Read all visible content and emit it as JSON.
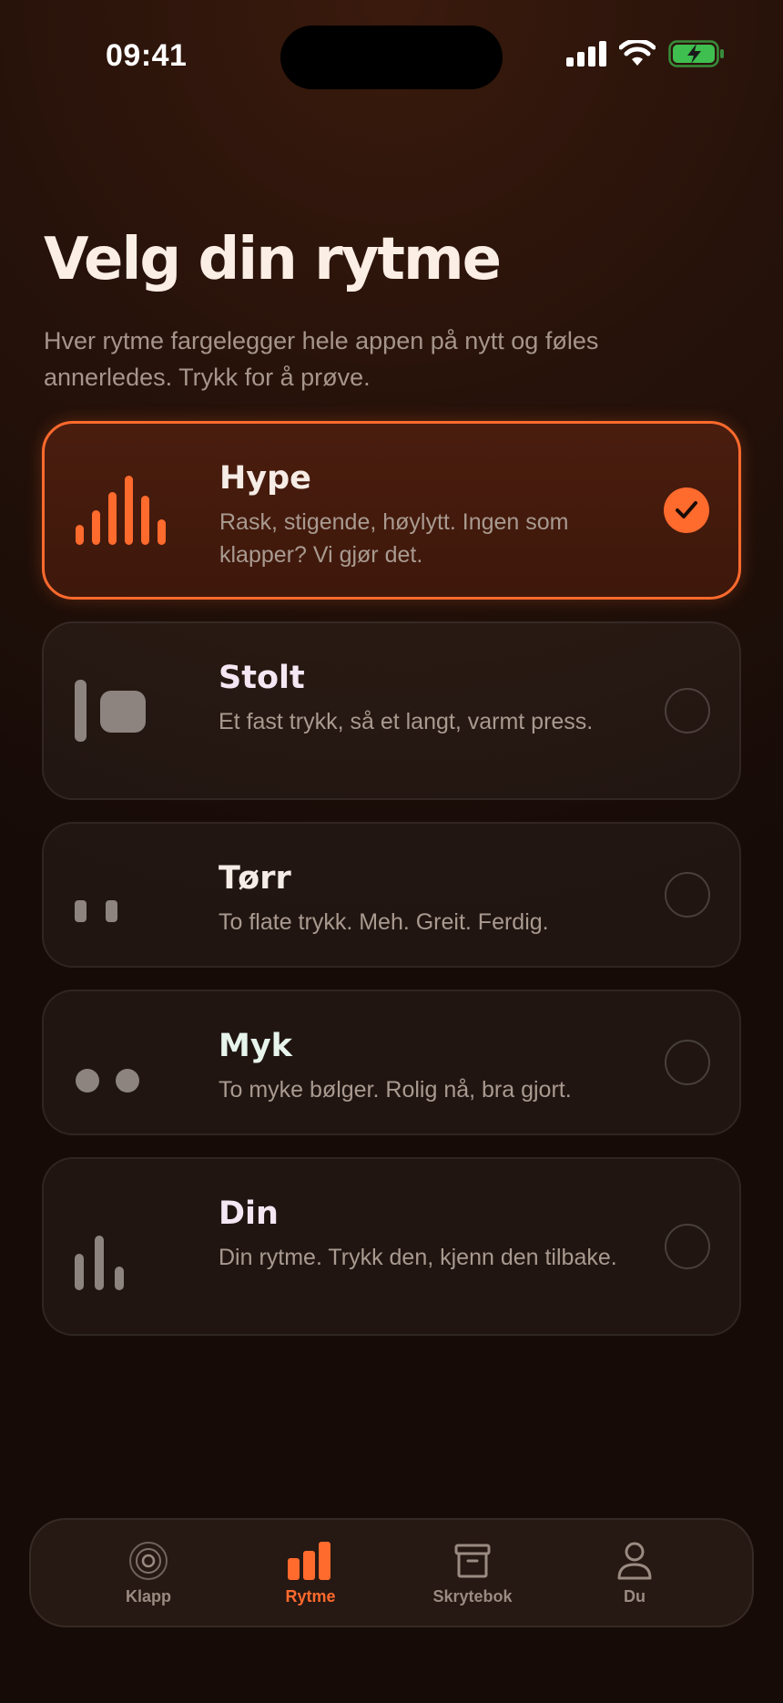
{
  "status_bar": {
    "time": "09:41"
  },
  "header": {
    "title": "Velg din rytme",
    "subtitle": "Hver rytme fargelegger hele appen på nytt og føles annerledes. Trykk for å prøve."
  },
  "rhythms": [
    {
      "name": "Hype",
      "description": "Rask, stigende, høylytt. Ingen som klapper? Vi gjør det.",
      "selected": true,
      "icon": "rising-bars-icon",
      "name_color": "#f6ece6"
    },
    {
      "name": "Stolt",
      "description": "Et fast trykk, så et langt, varmt press.",
      "selected": false,
      "icon": "tap-press-icon",
      "name_color": "#f4e6f2"
    },
    {
      "name": "Tørr",
      "description": "To flate trykk. Meh. Greit. Ferdig.",
      "selected": false,
      "icon": "two-flat-taps-icon",
      "name_color": "#f6ece6"
    },
    {
      "name": "Myk",
      "description": "To myke bølger. Rolig nå, bra gjort.",
      "selected": false,
      "icon": "two-soft-waves-icon",
      "name_color": "#e6f4ec"
    },
    {
      "name": "Din",
      "description": "Din rytme. Trykk den, kjenn den tilbake.",
      "selected": false,
      "icon": "custom-bars-icon",
      "name_color": "#f4e6f2"
    }
  ],
  "tab_bar": {
    "tabs": [
      {
        "label": "Klapp",
        "icon": "ripple-icon",
        "active": false
      },
      {
        "label": "Rytme",
        "icon": "bars-icon",
        "active": true
      },
      {
        "label": "Skrytebok",
        "icon": "archive-box-icon",
        "active": false
      },
      {
        "label": "Du",
        "icon": "person-icon",
        "active": false
      }
    ]
  },
  "colors": {
    "accent": "#ff6a2d",
    "background": "#1e0f09",
    "text_primary": "#fbeee4",
    "text_secondary": "#a6958b"
  }
}
